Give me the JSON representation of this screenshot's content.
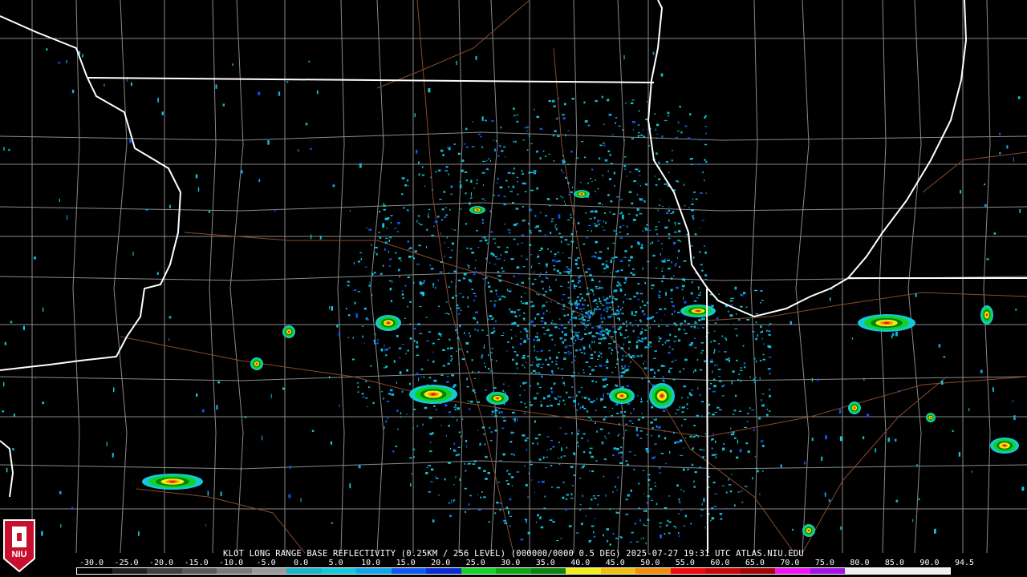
{
  "product": {
    "caption": "KLOT LONG RANGE BASE REFLECTIVITY (0.25KM / 256 LEVEL) (000000/0000 0.5 DEG) 2025-07-27 19:31 UTC  ATLAS.NIU.EDU"
  },
  "logo": {
    "text": "NIU"
  },
  "legend": {
    "tick_labels": [
      "-30.0",
      "-25.0",
      "-20.0",
      "-15.0",
      "-10.0",
      "-5.0",
      "0.0",
      "5.0",
      "10.0",
      "15.0",
      "20.0",
      "25.0",
      "30.0",
      "35.0",
      "40.0",
      "45.0",
      "50.0",
      "55.0",
      "60.0",
      "65.0",
      "70.0",
      "75.0",
      "80.0",
      "85.0",
      "90.0",
      "94.5"
    ],
    "colors": [
      "#000000",
      "#202020",
      "#404040",
      "#5a5a5a",
      "#7a7a7a",
      "#9a9a9a",
      "#16b4c8",
      "#14c8dc",
      "#12a4e6",
      "#0e5af0",
      "#0a2ad2",
      "#12d224",
      "#0ca614",
      "#0a820e",
      "#f0f014",
      "#f0be10",
      "#f08c0a",
      "#f00a0a",
      "#c80808",
      "#a00606",
      "#f014f0",
      "#a014e6",
      "#f0f0f0",
      "#f0f0f0",
      "#f0f0f0"
    ]
  },
  "map_layers": {
    "background": "#000000",
    "state_lines": "#ffffff",
    "county_lines": "#8a8a8a",
    "highways": "#8b4a2b",
    "lake": "Lake Michigan",
    "radar_site": "KLOT"
  }
}
